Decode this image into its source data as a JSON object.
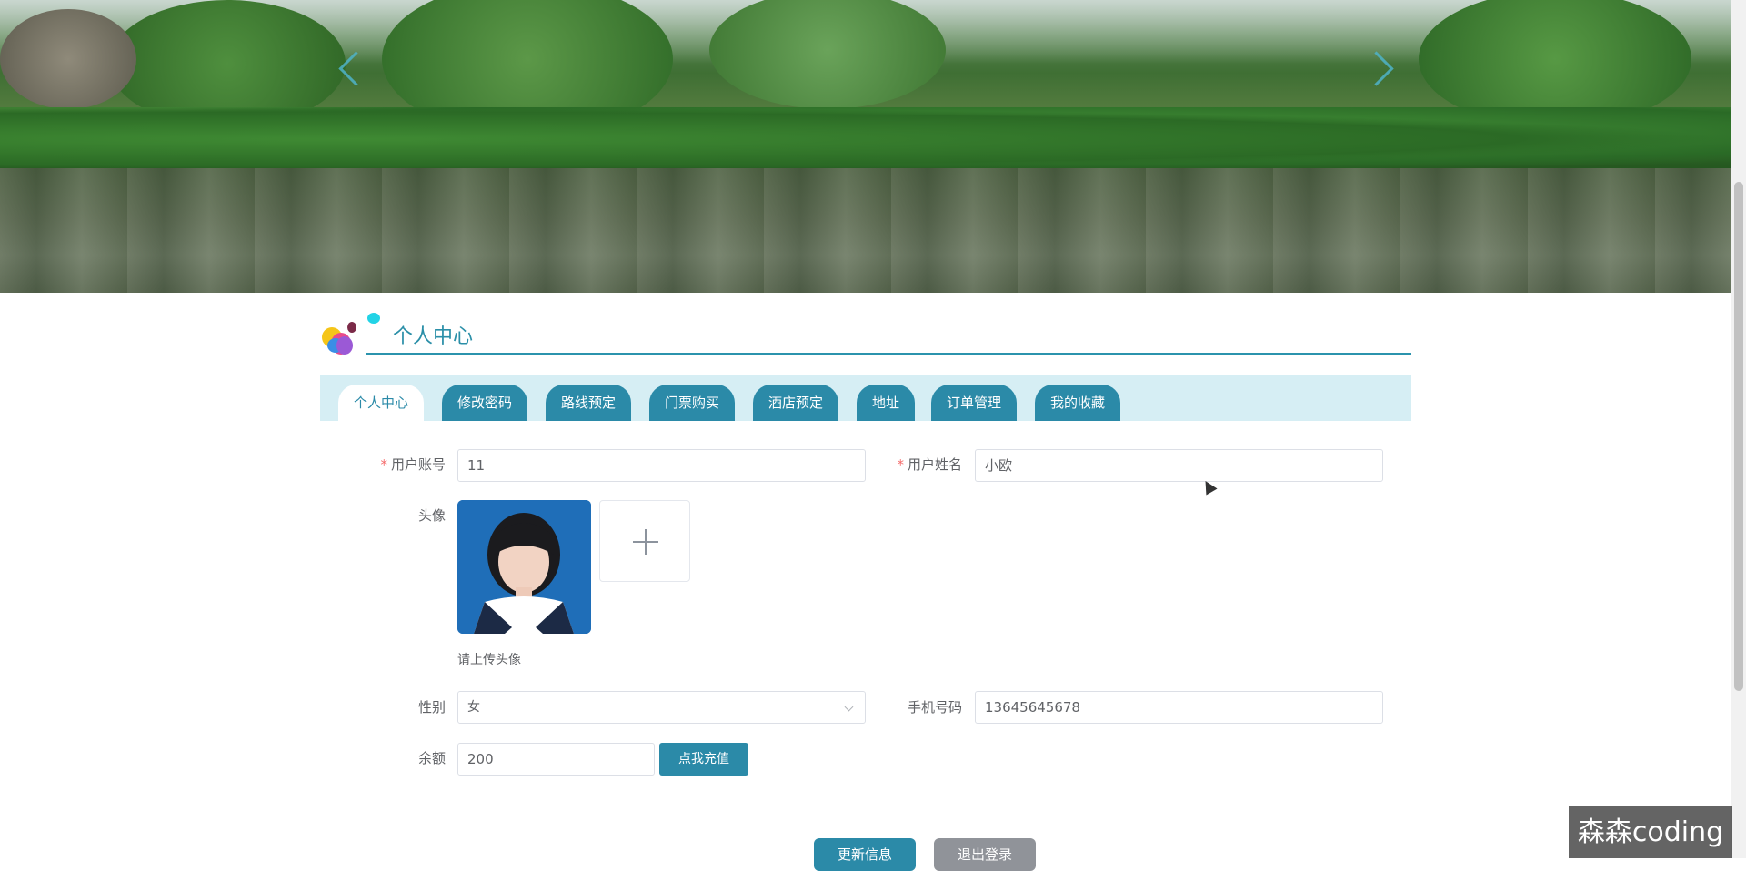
{
  "header": {
    "title": "个人中心"
  },
  "tabs": [
    {
      "label": "个人中心",
      "active": true
    },
    {
      "label": "修改密码",
      "active": false
    },
    {
      "label": "路线预定",
      "active": false
    },
    {
      "label": "门票购买",
      "active": false
    },
    {
      "label": "酒店预定",
      "active": false
    },
    {
      "label": "地址",
      "active": false
    },
    {
      "label": "订单管理",
      "active": false
    },
    {
      "label": "我的收藏",
      "active": false
    }
  ],
  "form": {
    "account_label": "用户账号",
    "account_value": "11",
    "name_label": "用户姓名",
    "name_value": "小欧",
    "avatar_label": "头像",
    "avatar_hint": "请上传头像",
    "gender_label": "性别",
    "gender_value": "女",
    "phone_label": "手机号码",
    "phone_value": "13645645678",
    "balance_label": "余额",
    "balance_value": "200",
    "required_mark": "*"
  },
  "buttons": {
    "recharge": "点我充值",
    "update": "更新信息",
    "logout": "退出登录"
  },
  "watermark": "森森coding",
  "colors": {
    "accent": "#2b8aa8",
    "tab_bar_bg": "#d6eef4",
    "required": "#f56c6c",
    "logout": "#909399"
  }
}
